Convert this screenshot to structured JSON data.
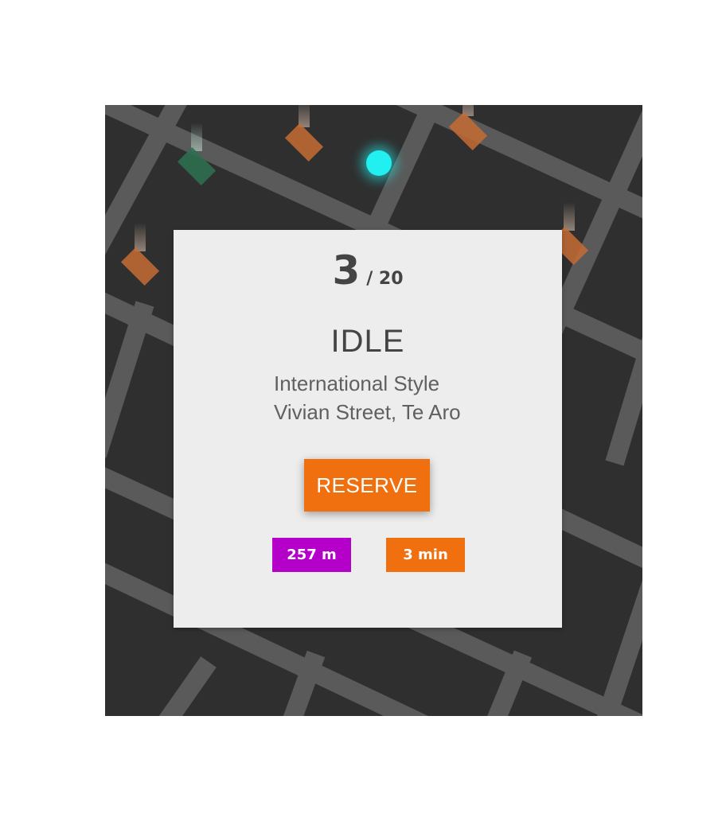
{
  "colors": {
    "map_background": "#2f2f2f",
    "street": "#5a5a5a",
    "card_background": "#ededed",
    "accent_orange": "#f07010",
    "distance_purple": "#b400c8",
    "user_location": "#22f0f0",
    "pin_orange": "#c66c34",
    "pin_green": "#2d6e50"
  },
  "card": {
    "current_index": "3",
    "total_label": "/ 20",
    "status": "IDLE",
    "place_name": "International Style",
    "place_address": "Vivian Street, Te Aro",
    "reserve_label": "RESERVE",
    "distance": "257 m",
    "eta": "3 min"
  },
  "map": {
    "user_location_icon": "location-dot-icon",
    "pin_icon": "map-pin-icon"
  }
}
